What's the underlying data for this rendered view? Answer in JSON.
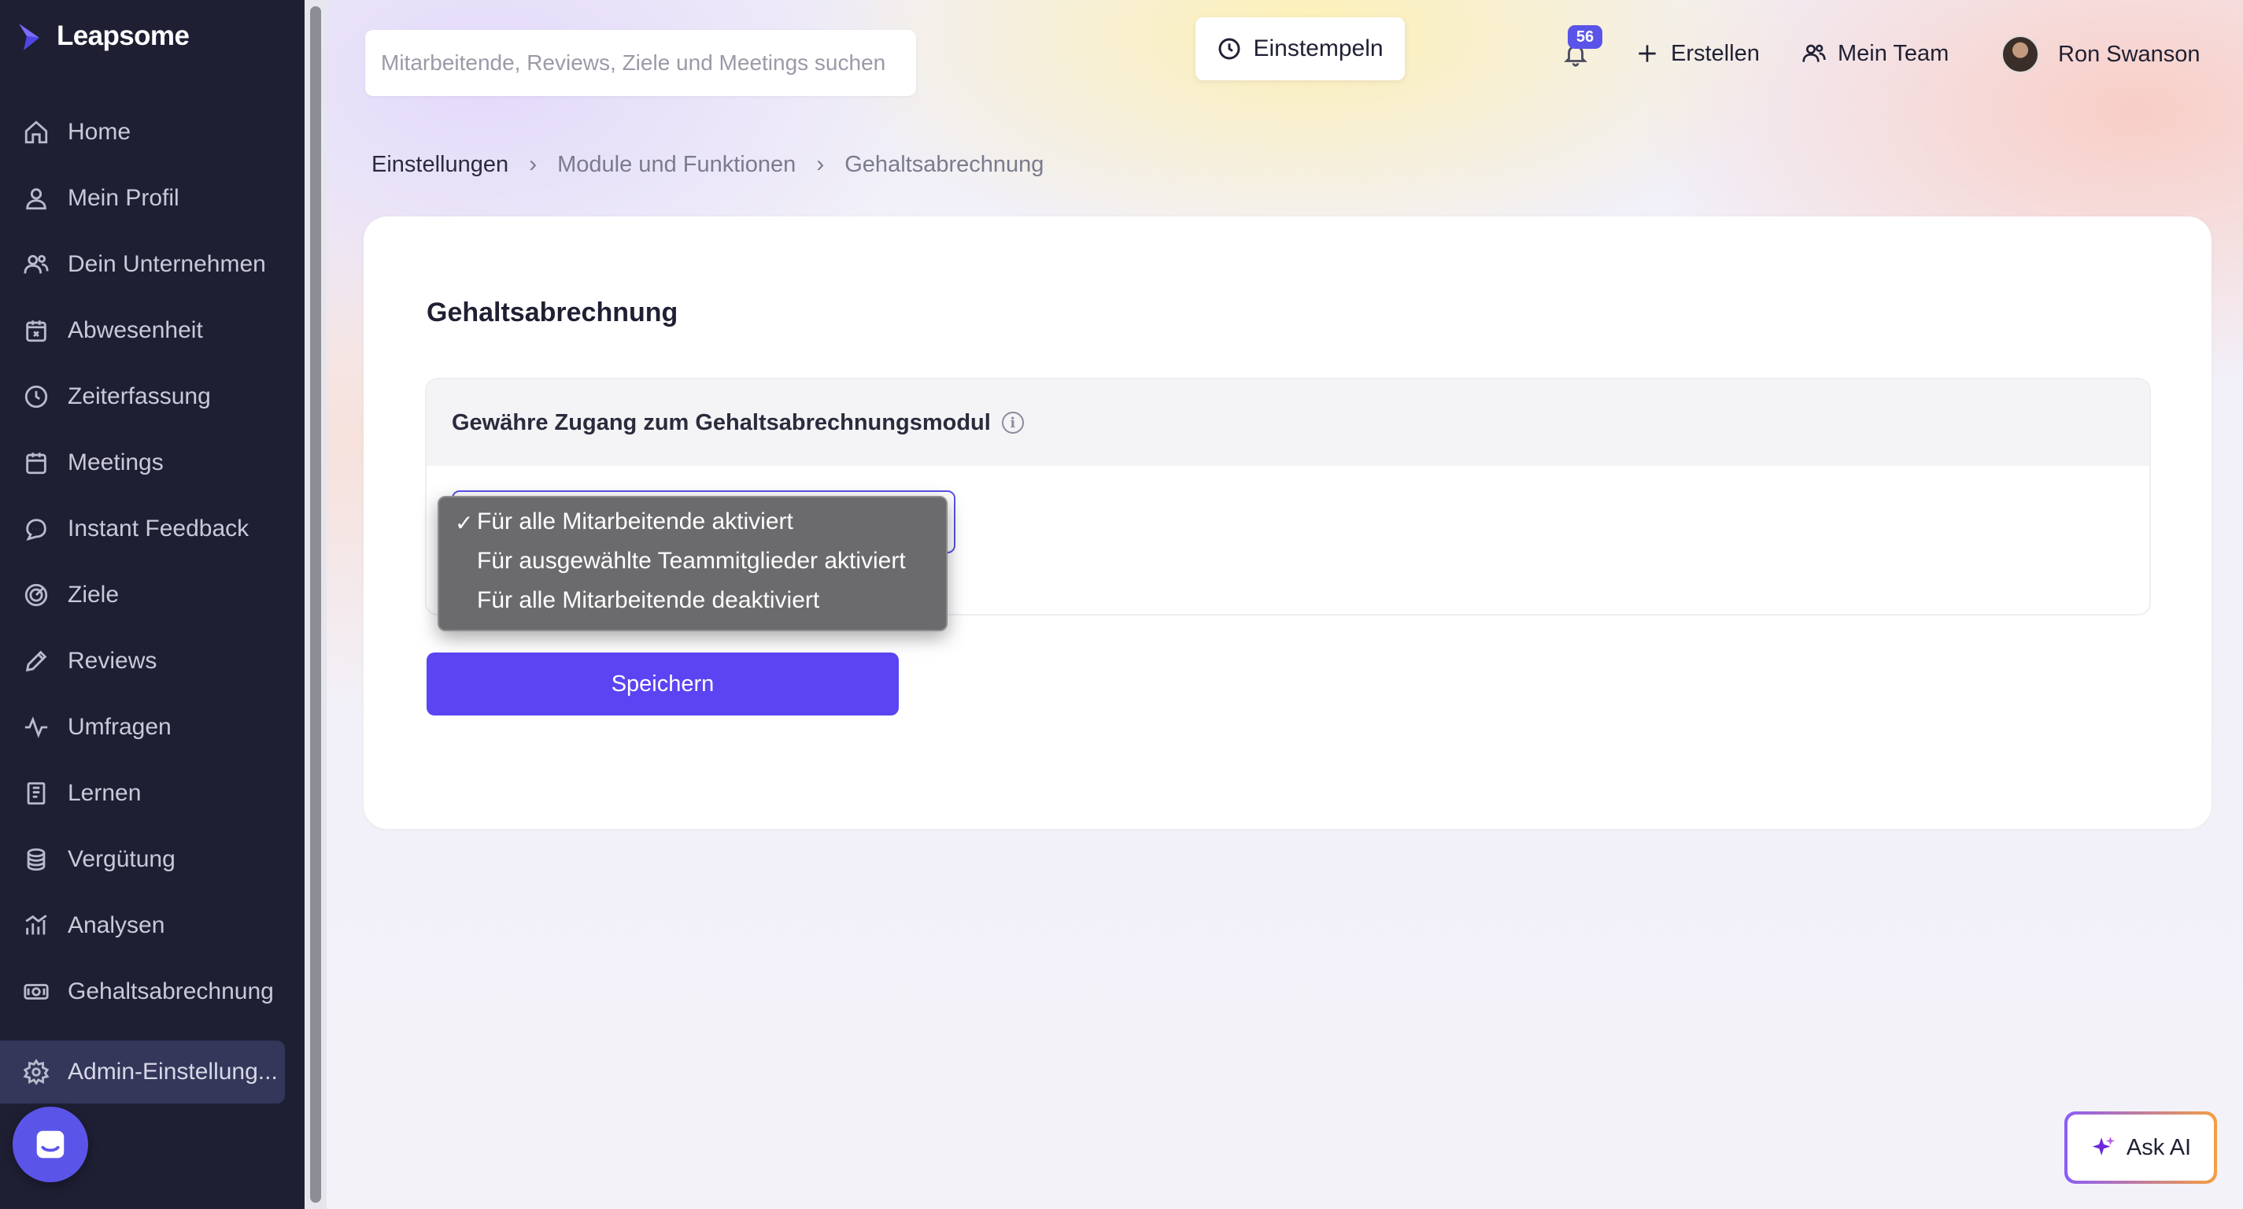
{
  "brand": {
    "name": "Leapsome",
    "accent": "#5b54e8"
  },
  "sidebar": {
    "items": [
      {
        "label": "Home",
        "icon": "home-icon"
      },
      {
        "label": "Mein Profil",
        "icon": "user-icon"
      },
      {
        "label": "Dein Unternehmen",
        "icon": "users-icon"
      },
      {
        "label": "Abwesenheit",
        "icon": "calendar-x-icon"
      },
      {
        "label": "Zeiterfassung",
        "icon": "clock-icon"
      },
      {
        "label": "Meetings",
        "icon": "calendar-icon"
      },
      {
        "label": "Instant Feedback",
        "icon": "chat-icon"
      },
      {
        "label": "Ziele",
        "icon": "target-icon"
      },
      {
        "label": "Reviews",
        "icon": "pencil-icon"
      },
      {
        "label": "Umfragen",
        "icon": "pulse-icon"
      },
      {
        "label": "Lernen",
        "icon": "book-icon"
      },
      {
        "label": "Vergütung",
        "icon": "coins-icon"
      },
      {
        "label": "Analysen",
        "icon": "bar-chart-icon"
      },
      {
        "label": "Gehaltsabrechnung",
        "icon": "banknote-icon"
      }
    ],
    "admin": {
      "label": "Admin-Einstellung...",
      "icon": "gear-icon"
    }
  },
  "header": {
    "search_placeholder": "Mitarbeitende, Reviews, Ziele und Meetings suchen",
    "clock_in_label": "Einstempeln",
    "notifications_count": "56",
    "create_label": "Erstellen",
    "team_label": "Mein Team",
    "user_name": "Ron Swanson"
  },
  "breadcrumb": [
    "Einstellungen",
    "Module und Funktionen",
    "Gehaltsabrechnung"
  ],
  "page": {
    "title": "Gehaltsabrechnung",
    "panel_title": "Gewähre Zugang zum Gehaltsabrechnungsmodul",
    "select_options": [
      {
        "label": "Für alle Mitarbeitende aktiviert",
        "selected": true
      },
      {
        "label": "Für ausgewählte Teammitglieder aktiviert",
        "selected": false
      },
      {
        "label": "Für alle Mitarbeitende deaktiviert",
        "selected": false
      }
    ],
    "check_mark": "✓",
    "save_label": "Speichern"
  },
  "ask_ai": {
    "label": "Ask AI"
  }
}
